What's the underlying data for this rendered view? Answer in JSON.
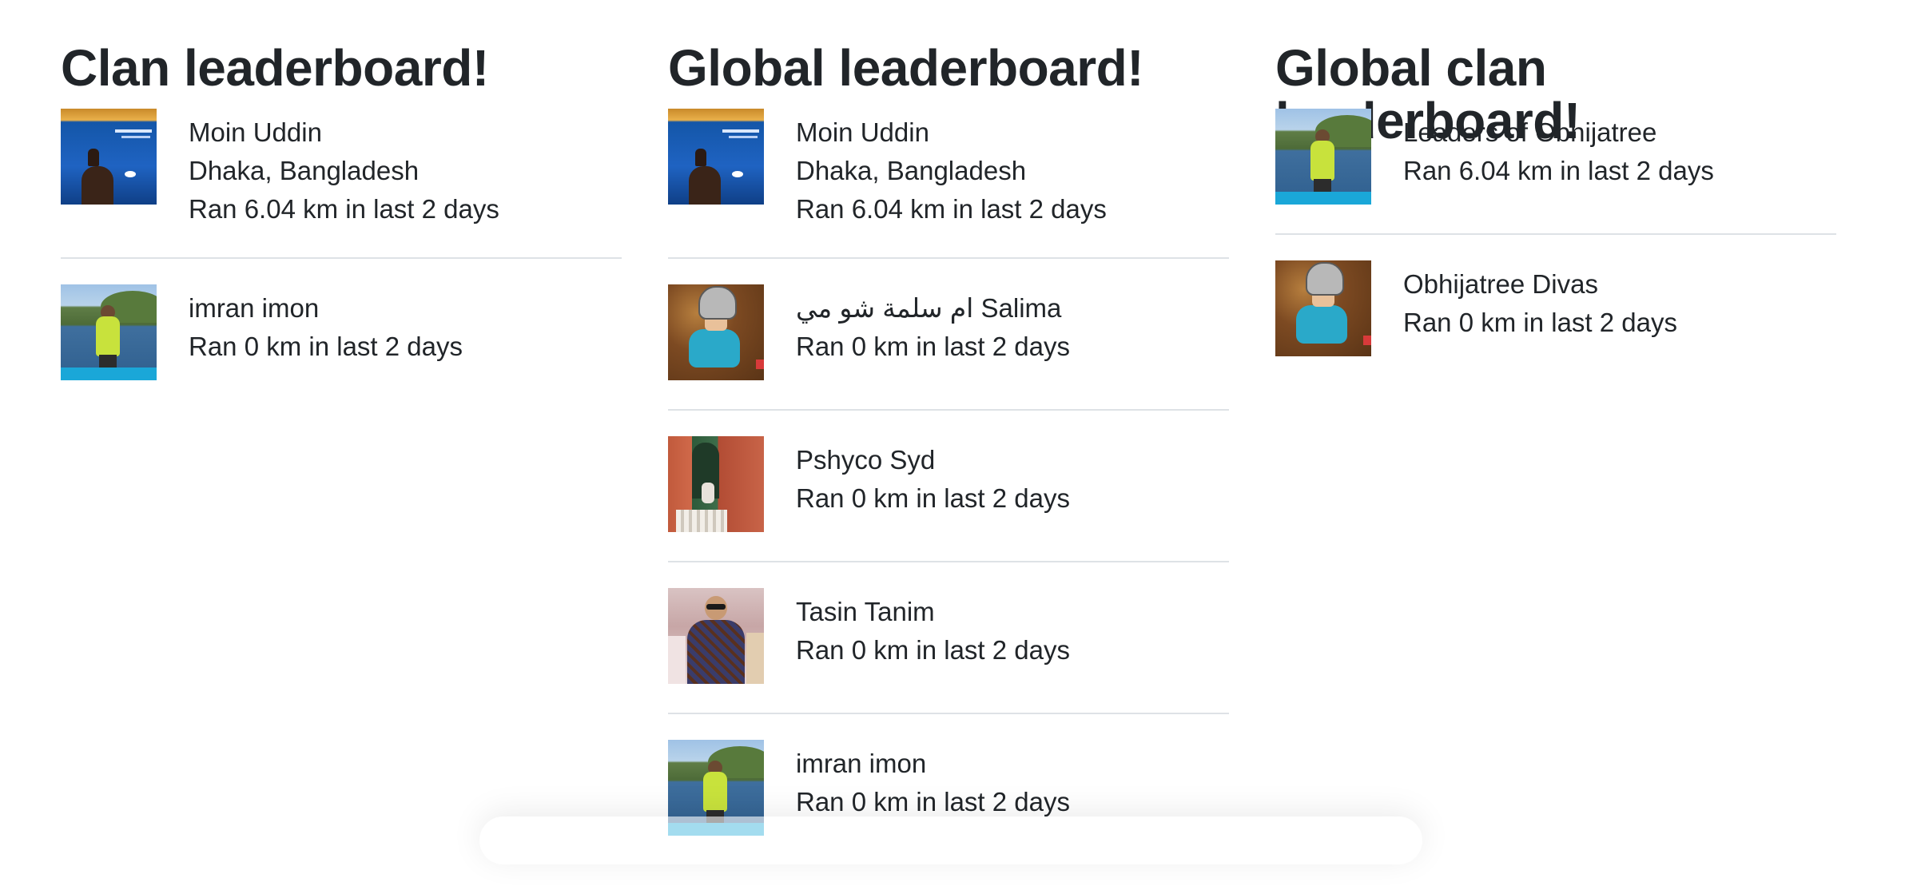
{
  "clan_leaderboard": {
    "title": "Clan leaderboard!",
    "entries": [
      {
        "avatar": "stage-photo",
        "name": "Moin Uddin",
        "location": "Dhaka, Bangladesh",
        "stat": "Ran 6.04 km in last 2 days"
      },
      {
        "avatar": "lake-photo",
        "name": "imran imon",
        "stat": "Ran 0 km in last 2 days"
      }
    ]
  },
  "global_leaderboard": {
    "title": "Global leaderboard!",
    "entries": [
      {
        "avatar": "stage-photo",
        "name": "Moin Uddin",
        "location": "Dhaka, Bangladesh",
        "stat": "Ran 6.04 km in last 2 days"
      },
      {
        "avatar": "leaves-photo",
        "name": "ام سلمة شو مي Salima",
        "stat": "Ran 0 km in last 2 days"
      },
      {
        "avatar": "temple-photo",
        "name": "Pshyco Syd",
        "stat": "Ran 0 km in last 2 days"
      },
      {
        "avatar": "crowd-photo",
        "name": "Tasin Tanim",
        "stat": "Ran 0 km in last 2 days"
      },
      {
        "avatar": "lake-photo",
        "name": "imran imon",
        "stat": "Ran 0 km in last 2 days"
      }
    ]
  },
  "global_clan_leaderboard": {
    "title": "Global clan leaderboard!",
    "entries": [
      {
        "avatar": "lake-photo",
        "name": "Leaders of Obhijatree",
        "stat": "Ran 6.04 km in last 2 days"
      },
      {
        "avatar": "leaves-photo",
        "name": "Obhijatree Divas",
        "stat": "Ran 0 km in last 2 days"
      }
    ]
  }
}
